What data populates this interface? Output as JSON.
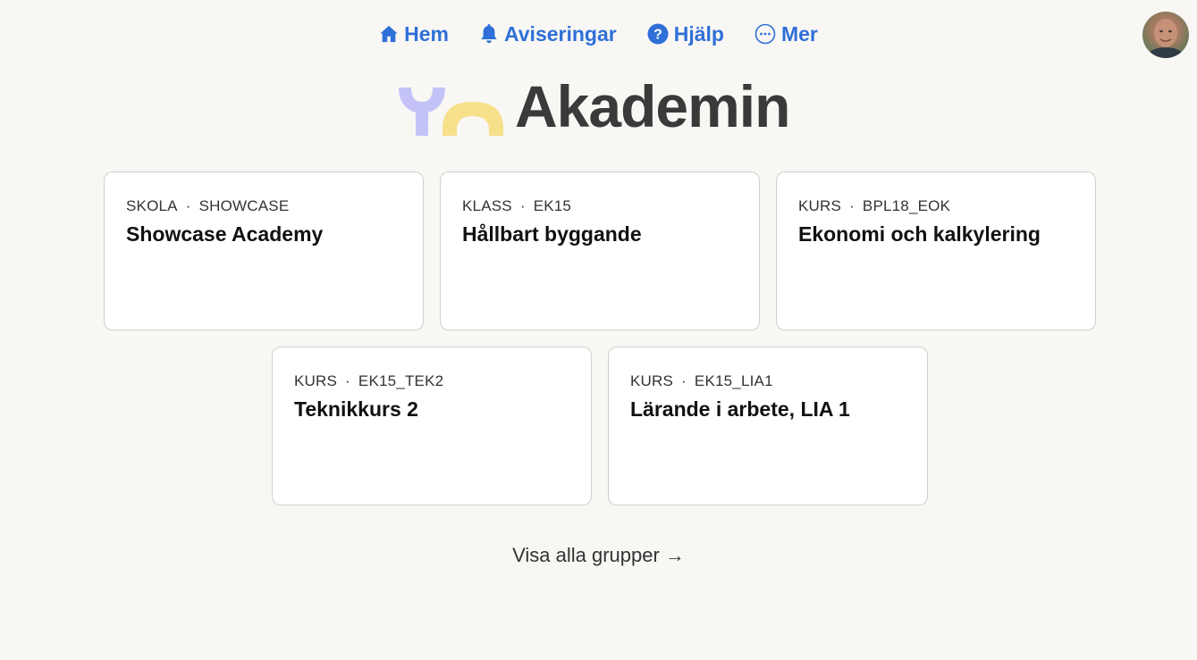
{
  "nav": {
    "items": [
      {
        "label": "Hem",
        "icon": "home-icon"
      },
      {
        "label": "Aviseringar",
        "icon": "bell-icon"
      },
      {
        "label": "Hjälp",
        "icon": "help-circle-icon"
      },
      {
        "label": "Mer",
        "icon": "more-circle-icon"
      }
    ],
    "accent_color": "#2f6fd8"
  },
  "logo": {
    "text": "Akademin"
  },
  "groups": [
    {
      "type": "SKOLA",
      "code": "SHOWCASE",
      "name": "Showcase Academy"
    },
    {
      "type": "KLASS",
      "code": "EK15",
      "name": "Hållbart byggande"
    },
    {
      "type": "KURS",
      "code": "BPL18_EOK",
      "name": "Ekonomi och kalkylering"
    },
    {
      "type": "KURS",
      "code": "EK15_TEK2",
      "name": "Teknikkurs 2"
    },
    {
      "type": "KURS",
      "code": "EK15_LIA1",
      "name": "Lärande i arbete, LIA 1"
    }
  ],
  "footer": {
    "all_groups_label": "Visa alla grupper →"
  }
}
